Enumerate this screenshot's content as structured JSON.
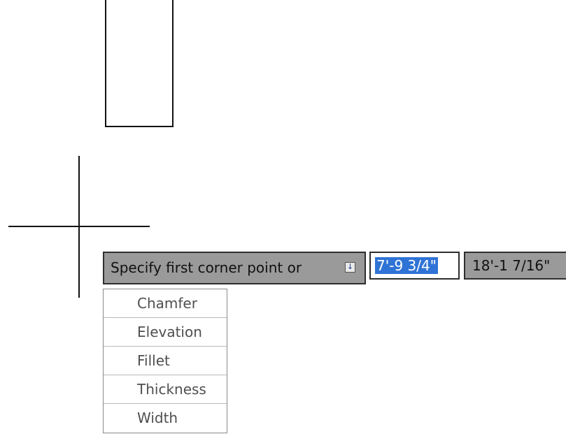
{
  "prompt": {
    "text": "Specify first corner point or",
    "options_icon": "dropdown-arrow-icon"
  },
  "coordinates": {
    "x_value": "7'-9 3/4\"",
    "y_value": "18'-1 7/16\""
  },
  "options": [
    {
      "label": "Chamfer"
    },
    {
      "label": "Elevation"
    },
    {
      "label": "Fillet"
    },
    {
      "label": "Thickness"
    },
    {
      "label": "Width"
    }
  ],
  "colors": {
    "tooltip_bg": "#9a9a9a",
    "selection": "#2f73d6",
    "option_text": "#4f4f4f"
  }
}
